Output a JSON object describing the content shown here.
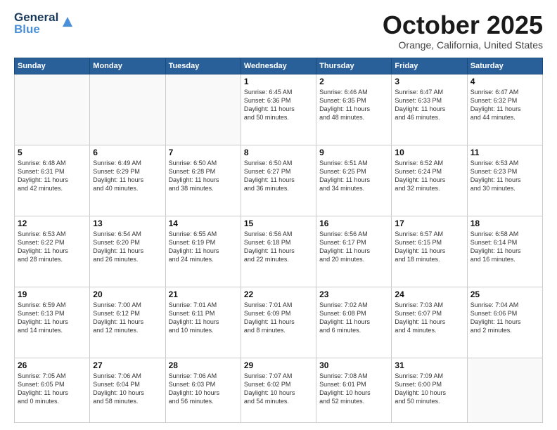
{
  "header": {
    "logo_general": "General",
    "logo_blue": "Blue",
    "month_title": "October 2025",
    "location": "Orange, California, United States"
  },
  "weekdays": [
    "Sunday",
    "Monday",
    "Tuesday",
    "Wednesday",
    "Thursday",
    "Friday",
    "Saturday"
  ],
  "weeks": [
    [
      {
        "day": "",
        "info": ""
      },
      {
        "day": "",
        "info": ""
      },
      {
        "day": "",
        "info": ""
      },
      {
        "day": "1",
        "info": "Sunrise: 6:45 AM\nSunset: 6:36 PM\nDaylight: 11 hours\nand 50 minutes."
      },
      {
        "day": "2",
        "info": "Sunrise: 6:46 AM\nSunset: 6:35 PM\nDaylight: 11 hours\nand 48 minutes."
      },
      {
        "day": "3",
        "info": "Sunrise: 6:47 AM\nSunset: 6:33 PM\nDaylight: 11 hours\nand 46 minutes."
      },
      {
        "day": "4",
        "info": "Sunrise: 6:47 AM\nSunset: 6:32 PM\nDaylight: 11 hours\nand 44 minutes."
      }
    ],
    [
      {
        "day": "5",
        "info": "Sunrise: 6:48 AM\nSunset: 6:31 PM\nDaylight: 11 hours\nand 42 minutes."
      },
      {
        "day": "6",
        "info": "Sunrise: 6:49 AM\nSunset: 6:29 PM\nDaylight: 11 hours\nand 40 minutes."
      },
      {
        "day": "7",
        "info": "Sunrise: 6:50 AM\nSunset: 6:28 PM\nDaylight: 11 hours\nand 38 minutes."
      },
      {
        "day": "8",
        "info": "Sunrise: 6:50 AM\nSunset: 6:27 PM\nDaylight: 11 hours\nand 36 minutes."
      },
      {
        "day": "9",
        "info": "Sunrise: 6:51 AM\nSunset: 6:25 PM\nDaylight: 11 hours\nand 34 minutes."
      },
      {
        "day": "10",
        "info": "Sunrise: 6:52 AM\nSunset: 6:24 PM\nDaylight: 11 hours\nand 32 minutes."
      },
      {
        "day": "11",
        "info": "Sunrise: 6:53 AM\nSunset: 6:23 PM\nDaylight: 11 hours\nand 30 minutes."
      }
    ],
    [
      {
        "day": "12",
        "info": "Sunrise: 6:53 AM\nSunset: 6:22 PM\nDaylight: 11 hours\nand 28 minutes."
      },
      {
        "day": "13",
        "info": "Sunrise: 6:54 AM\nSunset: 6:20 PM\nDaylight: 11 hours\nand 26 minutes."
      },
      {
        "day": "14",
        "info": "Sunrise: 6:55 AM\nSunset: 6:19 PM\nDaylight: 11 hours\nand 24 minutes."
      },
      {
        "day": "15",
        "info": "Sunrise: 6:56 AM\nSunset: 6:18 PM\nDaylight: 11 hours\nand 22 minutes."
      },
      {
        "day": "16",
        "info": "Sunrise: 6:56 AM\nSunset: 6:17 PM\nDaylight: 11 hours\nand 20 minutes."
      },
      {
        "day": "17",
        "info": "Sunrise: 6:57 AM\nSunset: 6:15 PM\nDaylight: 11 hours\nand 18 minutes."
      },
      {
        "day": "18",
        "info": "Sunrise: 6:58 AM\nSunset: 6:14 PM\nDaylight: 11 hours\nand 16 minutes."
      }
    ],
    [
      {
        "day": "19",
        "info": "Sunrise: 6:59 AM\nSunset: 6:13 PM\nDaylight: 11 hours\nand 14 minutes."
      },
      {
        "day": "20",
        "info": "Sunrise: 7:00 AM\nSunset: 6:12 PM\nDaylight: 11 hours\nand 12 minutes."
      },
      {
        "day": "21",
        "info": "Sunrise: 7:01 AM\nSunset: 6:11 PM\nDaylight: 11 hours\nand 10 minutes."
      },
      {
        "day": "22",
        "info": "Sunrise: 7:01 AM\nSunset: 6:09 PM\nDaylight: 11 hours\nand 8 minutes."
      },
      {
        "day": "23",
        "info": "Sunrise: 7:02 AM\nSunset: 6:08 PM\nDaylight: 11 hours\nand 6 minutes."
      },
      {
        "day": "24",
        "info": "Sunrise: 7:03 AM\nSunset: 6:07 PM\nDaylight: 11 hours\nand 4 minutes."
      },
      {
        "day": "25",
        "info": "Sunrise: 7:04 AM\nSunset: 6:06 PM\nDaylight: 11 hours\nand 2 minutes."
      }
    ],
    [
      {
        "day": "26",
        "info": "Sunrise: 7:05 AM\nSunset: 6:05 PM\nDaylight: 11 hours\nand 0 minutes."
      },
      {
        "day": "27",
        "info": "Sunrise: 7:06 AM\nSunset: 6:04 PM\nDaylight: 10 hours\nand 58 minutes."
      },
      {
        "day": "28",
        "info": "Sunrise: 7:06 AM\nSunset: 6:03 PM\nDaylight: 10 hours\nand 56 minutes."
      },
      {
        "day": "29",
        "info": "Sunrise: 7:07 AM\nSunset: 6:02 PM\nDaylight: 10 hours\nand 54 minutes."
      },
      {
        "day": "30",
        "info": "Sunrise: 7:08 AM\nSunset: 6:01 PM\nDaylight: 10 hours\nand 52 minutes."
      },
      {
        "day": "31",
        "info": "Sunrise: 7:09 AM\nSunset: 6:00 PM\nDaylight: 10 hours\nand 50 minutes."
      },
      {
        "day": "",
        "info": ""
      }
    ]
  ]
}
